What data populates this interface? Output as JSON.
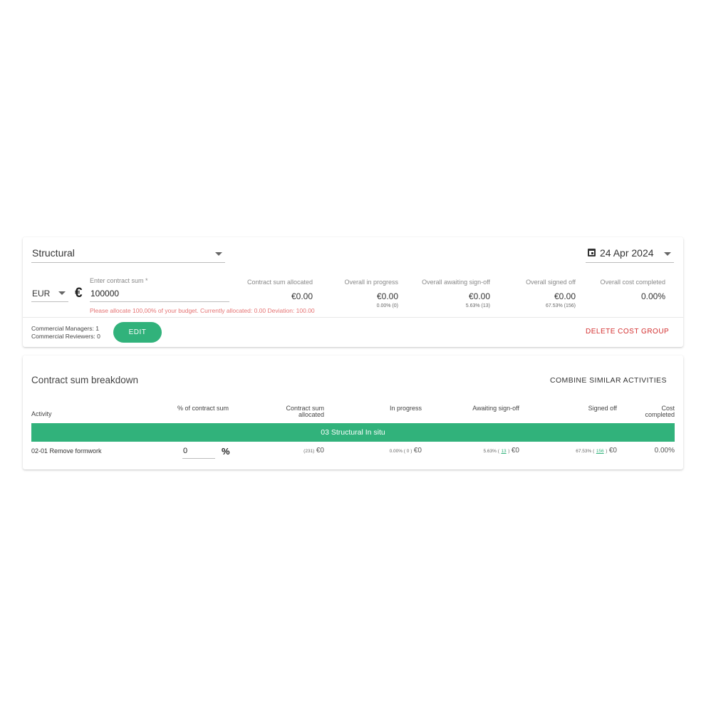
{
  "cost_group": {
    "name": "Structural",
    "date": "24 Apr 2024",
    "currency": "EUR",
    "currency_symbol": "€",
    "contract_sum_label": "Enter contract sum *",
    "contract_sum_value": "100000",
    "error_message": "Please allocate 100,00% of your budget. Currently allocated: 0.00 Deviation: 100.00",
    "stats": {
      "allocated": {
        "label": "Contract sum allocated",
        "value": "€0.00"
      },
      "in_progress": {
        "label": "Overall in progress",
        "value": "€0.00",
        "sub": "0.00% (0)"
      },
      "awaiting": {
        "label": "Overall awaiting sign-off",
        "value": "€0.00",
        "sub": "5.63% (13)"
      },
      "signed_off": {
        "label": "Overall signed off",
        "value": "€0.00",
        "sub": "67.53% (156)"
      },
      "cost_completed": {
        "label": "Overall cost completed",
        "value": "0.00%"
      }
    },
    "commercial_managers": "Commercial Managers: 1",
    "commercial_reviewers": "Commercial Reviewers: 0",
    "edit_label": "EDIT",
    "delete_label": "DELETE COST GROUP"
  },
  "breakdown": {
    "title": "Contract sum breakdown",
    "combine_label": "COMBINE SIMILAR ACTIVITIES",
    "headers": {
      "activity": "Activity",
      "percent": "% of contract sum",
      "allocated_1": "Contract sum",
      "allocated_2": "allocated",
      "in_progress": "In progress",
      "awaiting": "Awaiting sign-off",
      "signed_off": "Signed off",
      "cost_1": "Cost",
      "cost_2": "completed"
    },
    "group_name": "03 Structural In situ",
    "rows": [
      {
        "activity": "02-01 Remove formwork",
        "percent_value": "0",
        "percent_icon": "%",
        "allocated_count": "(231)",
        "allocated_value": "€0",
        "in_progress_pct": "0.00% ( 0 )",
        "in_progress_value": "€0",
        "awaiting_pct": "5.63% (",
        "awaiting_link": "13",
        "awaiting_close": ")",
        "awaiting_value": "€0",
        "signed_pct": "67.53% (",
        "signed_link": "156",
        "signed_close": ")",
        "signed_value": "€0",
        "cost_completed": "0.00%"
      }
    ]
  }
}
